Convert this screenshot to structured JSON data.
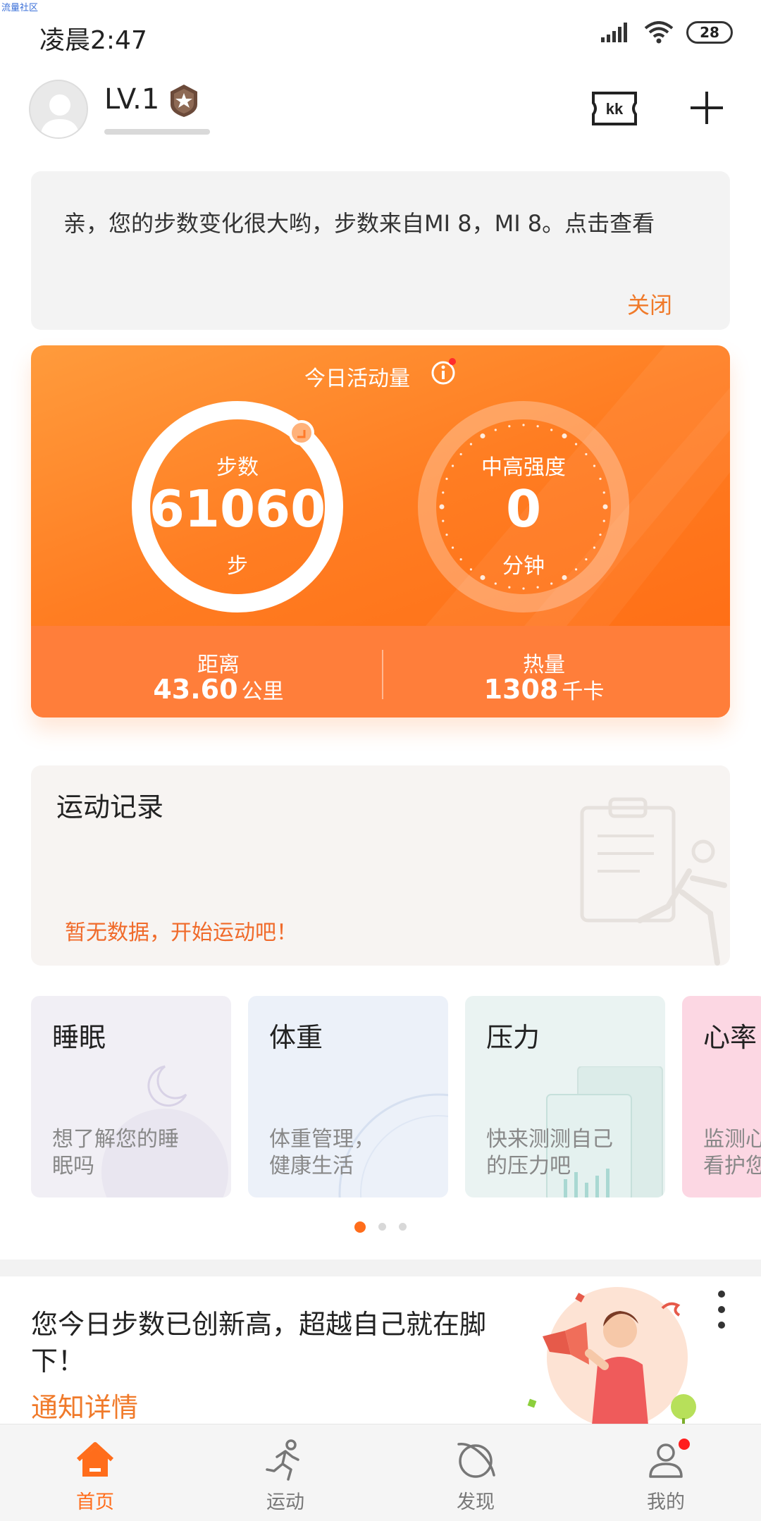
{
  "watermark": "流量社区",
  "status_bar": {
    "time": "凌晨2:47",
    "battery": "28",
    "icons": [
      "signal-icon",
      "wifi-icon",
      "battery-icon"
    ]
  },
  "header": {
    "level": "LV.1",
    "icons": [
      "avatar",
      "level-badge-icon",
      "kk-ticket-icon",
      "plus-icon"
    ]
  },
  "notice": {
    "text": "亲，您的步数变化很大哟，步数来自MI 8，MI 8。点击查看",
    "close": "关闭"
  },
  "activity": {
    "title": "今日活动量",
    "steps_label": "步数",
    "steps_value": "61060",
    "steps_unit": "步",
    "intensity_label": "中高强度",
    "intensity_value": "0",
    "intensity_unit": "分钟",
    "distance_label": "距离",
    "distance_value": "43.60",
    "distance_unit": "公里",
    "calories_label": "热量",
    "calories_value": "1308",
    "calories_unit": "千卡"
  },
  "record": {
    "title": "运动记录",
    "empty": "暂无数据，开始运动吧！"
  },
  "feature_cards": [
    {
      "title": "睡眠",
      "desc_line1": "想了解您的睡",
      "desc_line2": "眠吗"
    },
    {
      "title": "体重",
      "desc_line1": "体重管理，",
      "desc_line2": "健康生活"
    },
    {
      "title": "压力",
      "desc_line1": "快来测测自己",
      "desc_line2": "的压力吧"
    },
    {
      "title": "心率",
      "desc_line1": "监测心",
      "desc_line2": "看护您"
    }
  ],
  "pager": {
    "active_index": 0,
    "count": 3
  },
  "promo": {
    "text": "您今日步数已创新高，超越自己就在脚下！",
    "link": "通知详情"
  },
  "nav": [
    {
      "label": "首页",
      "icon": "home-icon",
      "active": true
    },
    {
      "label": "运动",
      "icon": "running-icon",
      "active": false
    },
    {
      "label": "发现",
      "icon": "planet-icon",
      "active": false
    },
    {
      "label": "我的",
      "icon": "profile-icon",
      "active": false
    }
  ],
  "colors": {
    "accent": "#ff6d1b",
    "link": "#f07a2a",
    "badge": "#ff1e1e"
  }
}
